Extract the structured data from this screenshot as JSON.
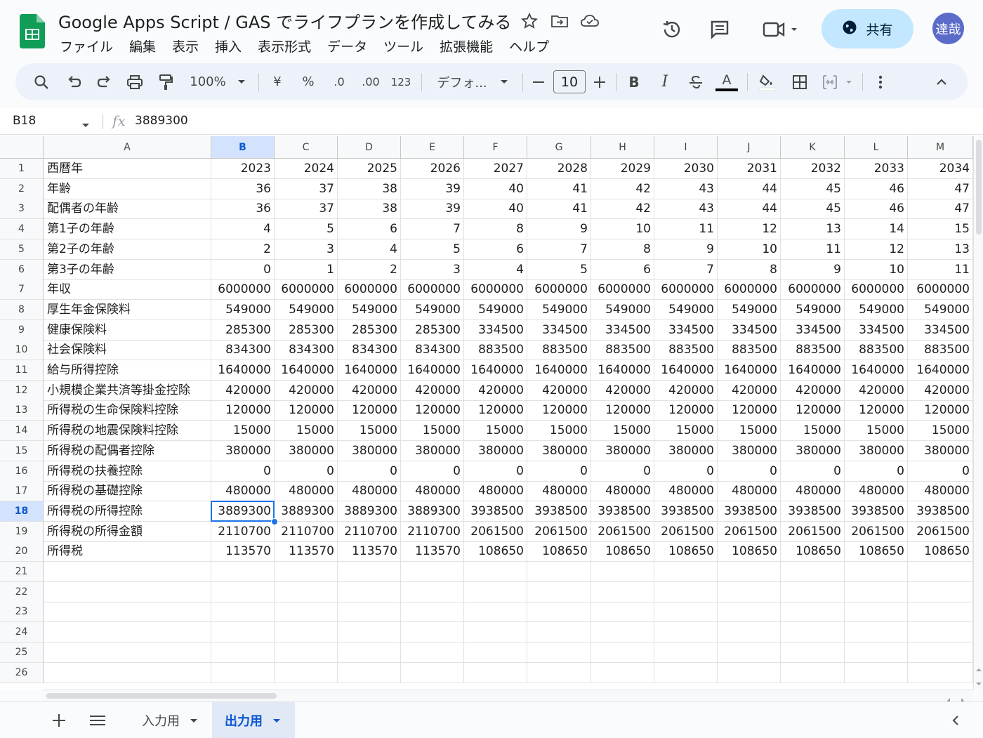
{
  "app": {
    "doc_title": "Google Apps Script / GAS でライフプランを作成してみる",
    "share_label": "共有",
    "avatar_text": "達哉"
  },
  "menu": [
    "ファイル",
    "編集",
    "表示",
    "挿入",
    "表示形式",
    "データ",
    "ツール",
    "拡張機能",
    "ヘルプ"
  ],
  "toolbar": {
    "zoom": "100%",
    "currency": "¥",
    "percent": "%",
    "dec_decrease": ".0",
    "dec_increase": ".00",
    "number_format": "123",
    "font": "デフォ...",
    "font_size": "10",
    "bold": "B",
    "italic": "I",
    "text_color_letter": "A"
  },
  "formula_bar": {
    "cell_ref": "B18",
    "fx": "fx",
    "value": "3889300"
  },
  "grid": {
    "columns": [
      "A",
      "B",
      "C",
      "D",
      "E",
      "F",
      "G",
      "H",
      "I",
      "J",
      "K",
      "L",
      "M"
    ],
    "selected_column": "B",
    "selected_row": "18",
    "row_numbers": [
      "1",
      "2",
      "3",
      "4",
      "5",
      "6",
      "7",
      "8",
      "9",
      "10",
      "11",
      "12",
      "13",
      "14",
      "15",
      "16",
      "17",
      "18",
      "19",
      "20",
      "21",
      "22",
      "23",
      "24",
      "25",
      "26"
    ],
    "rows": [
      [
        "西暦年",
        "2023",
        "2024",
        "2025",
        "2026",
        "2027",
        "2028",
        "2029",
        "2030",
        "2031",
        "2032",
        "2033",
        "2034"
      ],
      [
        "年齢",
        "36",
        "37",
        "38",
        "39",
        "40",
        "41",
        "42",
        "43",
        "44",
        "45",
        "46",
        "47"
      ],
      [
        "配偶者の年齢",
        "36",
        "37",
        "38",
        "39",
        "40",
        "41",
        "42",
        "43",
        "44",
        "45",
        "46",
        "47"
      ],
      [
        "第1子の年齢",
        "4",
        "5",
        "6",
        "7",
        "8",
        "9",
        "10",
        "11",
        "12",
        "13",
        "14",
        "15"
      ],
      [
        "第2子の年齢",
        "2",
        "3",
        "4",
        "5",
        "6",
        "7",
        "8",
        "9",
        "10",
        "11",
        "12",
        "13"
      ],
      [
        "第3子の年齢",
        "0",
        "1",
        "2",
        "3",
        "4",
        "5",
        "6",
        "7",
        "8",
        "9",
        "10",
        "11"
      ],
      [
        "年収",
        "6000000",
        "6000000",
        "6000000",
        "6000000",
        "6000000",
        "6000000",
        "6000000",
        "6000000",
        "6000000",
        "6000000",
        "6000000",
        "6000000"
      ],
      [
        "厚生年金保険料",
        "549000",
        "549000",
        "549000",
        "549000",
        "549000",
        "549000",
        "549000",
        "549000",
        "549000",
        "549000",
        "549000",
        "549000"
      ],
      [
        "健康保険料",
        "285300",
        "285300",
        "285300",
        "285300",
        "334500",
        "334500",
        "334500",
        "334500",
        "334500",
        "334500",
        "334500",
        "334500"
      ],
      [
        "社会保険料",
        "834300",
        "834300",
        "834300",
        "834300",
        "883500",
        "883500",
        "883500",
        "883500",
        "883500",
        "883500",
        "883500",
        "883500"
      ],
      [
        "給与所得控除",
        "1640000",
        "1640000",
        "1640000",
        "1640000",
        "1640000",
        "1640000",
        "1640000",
        "1640000",
        "1640000",
        "1640000",
        "1640000",
        "1640000"
      ],
      [
        "小規模企業共済等掛金控除",
        "420000",
        "420000",
        "420000",
        "420000",
        "420000",
        "420000",
        "420000",
        "420000",
        "420000",
        "420000",
        "420000",
        "420000"
      ],
      [
        "所得税の生命保険料控除",
        "120000",
        "120000",
        "120000",
        "120000",
        "120000",
        "120000",
        "120000",
        "120000",
        "120000",
        "120000",
        "120000",
        "120000"
      ],
      [
        "所得税の地震保険料控除",
        "15000",
        "15000",
        "15000",
        "15000",
        "15000",
        "15000",
        "15000",
        "15000",
        "15000",
        "15000",
        "15000",
        "15000"
      ],
      [
        "所得税の配偶者控除",
        "380000",
        "380000",
        "380000",
        "380000",
        "380000",
        "380000",
        "380000",
        "380000",
        "380000",
        "380000",
        "380000",
        "380000"
      ],
      [
        "所得税の扶養控除",
        "0",
        "0",
        "0",
        "0",
        "0",
        "0",
        "0",
        "0",
        "0",
        "0",
        "0",
        "0"
      ],
      [
        "所得税の基礎控除",
        "480000",
        "480000",
        "480000",
        "480000",
        "480000",
        "480000",
        "480000",
        "480000",
        "480000",
        "480000",
        "480000",
        "480000"
      ],
      [
        "所得税の所得控除",
        "3889300",
        "3889300",
        "3889300",
        "3889300",
        "3938500",
        "3938500",
        "3938500",
        "3938500",
        "3938500",
        "3938500",
        "3938500",
        "3938500"
      ],
      [
        "所得税の所得金額",
        "2110700",
        "2110700",
        "2110700",
        "2110700",
        "2061500",
        "2061500",
        "2061500",
        "2061500",
        "2061500",
        "2061500",
        "2061500",
        "2061500"
      ],
      [
        "所得税",
        "113570",
        "113570",
        "113570",
        "113570",
        "108650",
        "108650",
        "108650",
        "108650",
        "108650",
        "108650",
        "108650",
        "108650"
      ]
    ]
  },
  "sheets": [
    {
      "label": "入力用",
      "active": false
    },
    {
      "label": "出力用",
      "active": true
    }
  ],
  "colors": {
    "accent": "#1a73e8",
    "share_bg": "#c2e7ff",
    "selected_header": "#d3e3fd",
    "sheets_green": "#0f9d58"
  }
}
